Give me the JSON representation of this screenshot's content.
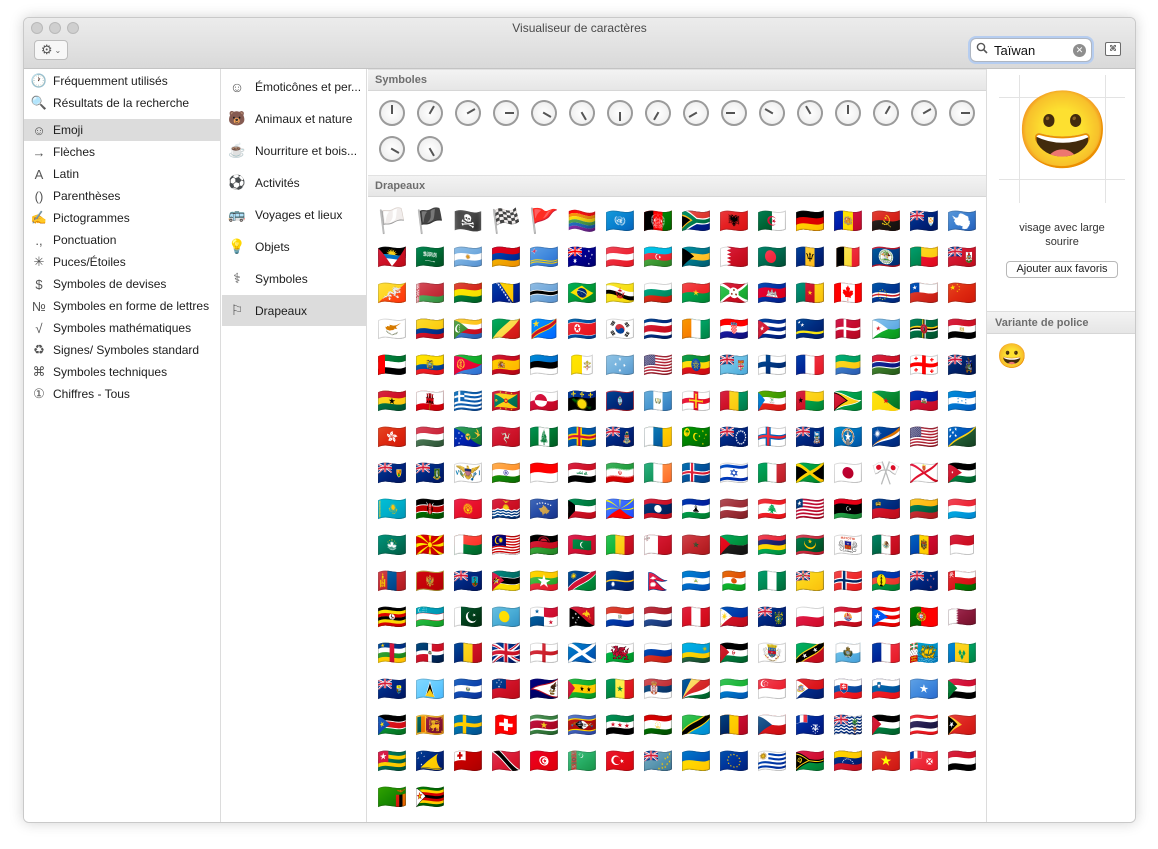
{
  "window": {
    "title": "Visualiseur de caractères"
  },
  "toolbar": {
    "gear_icon": "⚙",
    "chevron_icon": "⌄",
    "search_value": "Taïwan",
    "search_icon": "🔍",
    "clear_icon": "✕",
    "keyboard_icon": "⌘"
  },
  "categories": [
    {
      "icon": "🕐",
      "label": "Fréquemment utilisés"
    },
    {
      "icon": "🔍",
      "label": "Résultats de la recherche"
    },
    {
      "icon": "☺",
      "label": "Emoji",
      "selected": true
    },
    {
      "icon": "→",
      "label": "Flèches"
    },
    {
      "icon": "A",
      "label": "Latin"
    },
    {
      "icon": "()",
      "label": "Parenthèses"
    },
    {
      "icon": "✍",
      "label": "Pictogrammes"
    },
    {
      "icon": ".,",
      "label": "Ponctuation"
    },
    {
      "icon": "✳",
      "label": "Puces/Étoiles"
    },
    {
      "icon": "$",
      "label": "Symboles de devises"
    },
    {
      "icon": "№",
      "label": "Symboles en forme de lettres"
    },
    {
      "icon": "√",
      "label": "Symboles mathématiques"
    },
    {
      "icon": "♻",
      "label": "Signes/ Symboles standard"
    },
    {
      "icon": "⌘",
      "label": "Symboles techniques"
    },
    {
      "icon": "①",
      "label": "Chiffres - Tous"
    }
  ],
  "subcategories": [
    {
      "icon": "☺",
      "label": "Émoticônes et per..."
    },
    {
      "icon": "🐻",
      "label": "Animaux et nature"
    },
    {
      "icon": "☕",
      "label": "Nourriture et bois..."
    },
    {
      "icon": "⚽",
      "label": "Activités"
    },
    {
      "icon": "🚌",
      "label": "Voyages et lieux"
    },
    {
      "icon": "💡",
      "label": "Objets"
    },
    {
      "icon": "⚕",
      "label": "Symboles"
    },
    {
      "icon": "⚐",
      "label": "Drapeaux",
      "selected": true
    }
  ],
  "sections": {
    "symbols_header": "Symboles",
    "flags_header": "Drapeaux"
  },
  "clock_count": 18,
  "flags": [
    "🏳️",
    "🏴",
    "🏴‍☠️",
    "🏁",
    "🚩",
    "🏳️‍🌈",
    "🇺🇳",
    "🇦🇫",
    "🇿🇦",
    "🇦🇱",
    "🇩🇿",
    "🇩🇪",
    "🇦🇩",
    "🇦🇴",
    "🇦🇮",
    "🇦🇶",
    "🇦🇬",
    "🇸🇦",
    "🇦🇷",
    "🇦🇲",
    "🇦🇼",
    "🇦🇺",
    "🇦🇹",
    "🇦🇿",
    "🇧🇸",
    "🇧🇭",
    "🇧🇩",
    "🇧🇧",
    "🇧🇪",
    "🇧🇿",
    "🇧🇯",
    "🇧🇲",
    "🇧🇹",
    "🇧🇾",
    "🇧🇴",
    "🇧🇦",
    "🇧🇼",
    "🇧🇷",
    "🇧🇳",
    "🇧🇬",
    "🇧🇫",
    "🇧🇮",
    "🇰🇭",
    "🇨🇲",
    "🇨🇦",
    "🇨🇻",
    "🇨🇱",
    "🇨🇳",
    "🇨🇾",
    "🇨🇴",
    "🇰🇲",
    "🇨🇬",
    "🇨🇩",
    "🇰🇵",
    "🇰🇷",
    "🇨🇷",
    "🇨🇮",
    "🇭🇷",
    "🇨🇺",
    "🇨🇼",
    "🇩🇰",
    "🇩🇯",
    "🇩🇲",
    "🇪🇬",
    "🇦🇪",
    "🇪🇨",
    "🇪🇷",
    "🇪🇸",
    "🇪🇪",
    "🇻🇦",
    "🇫🇲",
    "🇺🇸",
    "🇪🇹",
    "🇫🇯",
    "🇫🇮",
    "🇫🇷",
    "🇬🇦",
    "🇬🇲",
    "🇬🇪",
    "🇬🇸",
    "🇬🇭",
    "🇬🇮",
    "🇬🇷",
    "🇬🇩",
    "🇬🇱",
    "🇬🇵",
    "🇬🇺",
    "🇬🇹",
    "🇬🇬",
    "🇬🇳",
    "🇬🇶",
    "🇬🇼",
    "🇬🇾",
    "🇬🇫",
    "🇭🇹",
    "🇭🇳",
    "🇭🇰",
    "🇭🇺",
    "🇨🇽",
    "🇮🇲",
    "🇳🇫",
    "🇦🇽",
    "🇰🇾",
    "🇮🇨",
    "🇨🇨",
    "🇨🇰",
    "🇫🇴",
    "🇫🇰",
    "🇲🇵",
    "🇲🇭",
    "🇺🇲",
    "🇸🇧",
    "🇹🇨",
    "🇻🇬",
    "🇻🇮",
    "🇮🇳",
    "🇮🇩",
    "🇮🇶",
    "🇮🇷",
    "🇮🇪",
    "🇮🇸",
    "🇮🇱",
    "🇮🇹",
    "🇯🇲",
    "🇯🇵",
    "🎌",
    "🇯🇪",
    "🇯🇴",
    "🇰🇿",
    "🇰🇪",
    "🇰🇬",
    "🇰🇮",
    "🇽🇰",
    "🇰🇼",
    "🇷🇪",
    "🇱🇦",
    "🇱🇸",
    "🇱🇻",
    "🇱🇧",
    "🇱🇷",
    "🇱🇾",
    "🇱🇮",
    "🇱🇹",
    "🇱🇺",
    "🇲🇴",
    "🇲🇰",
    "🇲🇬",
    "🇲🇾",
    "🇲🇼",
    "🇲🇻",
    "🇲🇱",
    "🇲🇹",
    "🇲🇦",
    "🇲🇶",
    "🇲🇺",
    "🇲🇷",
    "🇾🇹",
    "🇲🇽",
    "🇲🇩",
    "🇲🇨",
    "🇲🇳",
    "🇲🇪",
    "🇲🇸",
    "🇲🇿",
    "🇲🇲",
    "🇳🇦",
    "🇳🇷",
    "🇳🇵",
    "🇳🇮",
    "🇳🇪",
    "🇳🇬",
    "🇳🇺",
    "🇳🇴",
    "🇳🇨",
    "🇳🇿",
    "🇴🇲",
    "🇺🇬",
    "🇺🇿",
    "🇵🇰",
    "🇵🇼",
    "🇵🇦",
    "🇵🇬",
    "🇵🇾",
    "🇳🇱",
    "🇵🇪",
    "🇵🇭",
    "🇵🇳",
    "🇵🇱",
    "🇵🇫",
    "🇵🇷",
    "🇵🇹",
    "🇶🇦",
    "🇨🇫",
    "🇩🇴",
    "🇷🇴",
    "🇬🇧",
    "🏴󠁧󠁢󠁥󠁮󠁧󠁿",
    "🏴󠁧󠁢󠁳󠁣󠁴󠁿",
    "🏴󠁧󠁢󠁷󠁬󠁳󠁿",
    "🇷🇺",
    "🇷🇼",
    "🇪🇭",
    "🇧🇱",
    "🇰🇳",
    "🇸🇲",
    "🇲🇫",
    "🇵🇲",
    "🇻🇨",
    "🇸🇭",
    "🇱🇨",
    "🇸🇻",
    "🇼🇸",
    "🇦🇸",
    "🇸🇹",
    "🇸🇳",
    "🇷🇸",
    "🇸🇨",
    "🇸🇱",
    "🇸🇬",
    "🇸🇽",
    "🇸🇰",
    "🇸🇮",
    "🇸🇴",
    "🇸🇩",
    "🇸🇸",
    "🇱🇰",
    "🇸🇪",
    "🇨🇭",
    "🇸🇷",
    "🇸🇿",
    "🇸🇾",
    "🇹🇯",
    "🇹🇿",
    "🇹🇩",
    "🇨🇿",
    "🇹🇫",
    "🇮🇴",
    "🇵🇸",
    "🇹🇭",
    "🇹🇱",
    "🇹🇬",
    "🇹🇰",
    "🇹🇴",
    "🇹🇹",
    "🇹🇳",
    "🇹🇲",
    "🇹🇷",
    "🇹🇻",
    "🇺🇦",
    "🇪🇺",
    "🇺🇾",
    "🇻🇺",
    "🇻🇪",
    "🇻🇳",
    "🇼🇫",
    "🇾🇪",
    "🇿🇲",
    "🇿🇼"
  ],
  "inspector": {
    "preview_char": "😀",
    "char_name": "visage avec large sourire",
    "favorite_button": "Ajouter aux favoris",
    "variant_header": "Variante de police",
    "variant_char": "😀"
  }
}
